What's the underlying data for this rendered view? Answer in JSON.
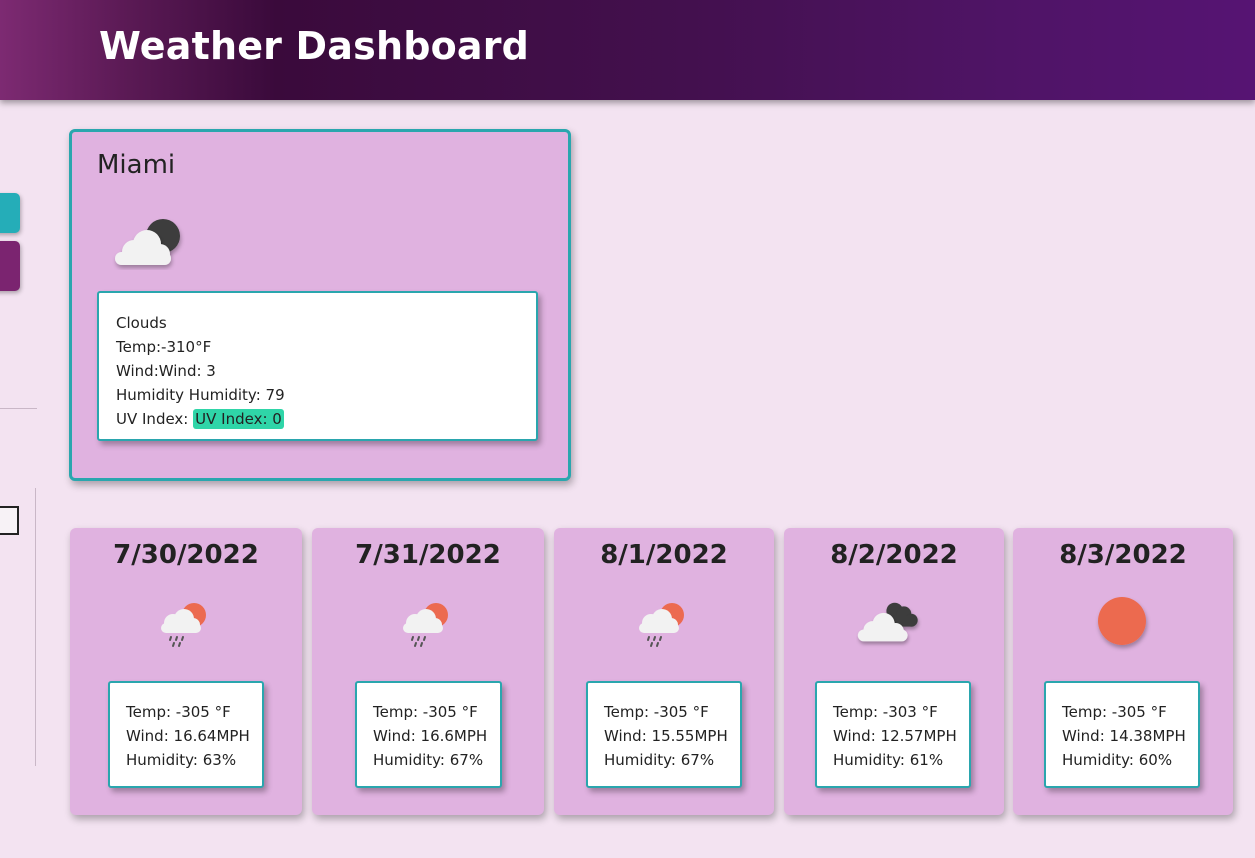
{
  "header": {
    "title": "Weather Dashboard"
  },
  "current": {
    "city": "Miami",
    "icon": "clouds-night-icon",
    "description": "Clouds",
    "temp_label": "Temp:",
    "temp": "-310°F",
    "wind_label": "Wind:",
    "wind": "Wind: 3",
    "humidity_label": "Humidity",
    "humidity": "Humidity: 79",
    "uv_label": "UV Index:",
    "uv": "UV Index: 0",
    "uv_color": "#2fd5a8"
  },
  "forecast": [
    {
      "date": "7/30/2022",
      "icon": "rain-sun-icon",
      "temp": "Temp: -305 °F",
      "wind": "Wind: 16.64MPH",
      "humidity": "Humidity: 63%"
    },
    {
      "date": "7/31/2022",
      "icon": "rain-sun-icon",
      "temp": "Temp: -305 °F",
      "wind": "Wind: 16.6MPH",
      "humidity": "Humidity: 67%"
    },
    {
      "date": "8/1/2022",
      "icon": "rain-sun-icon",
      "temp": "Temp: -305 °F",
      "wind": "Wind: 15.55MPH",
      "humidity": "Humidity: 67%"
    },
    {
      "date": "8/2/2022",
      "icon": "broken-clouds-icon",
      "temp": "Temp: -303 °F",
      "wind": "Wind: 12.57MPH",
      "humidity": "Humidity: 61%"
    },
    {
      "date": "8/3/2022",
      "icon": "sun-icon",
      "temp": "Temp: -305 °F",
      "wind": "Wind: 14.38MPH",
      "humidity": "Humidity: 60%"
    }
  ],
  "colors": {
    "accent": "#2aa6ae",
    "card": "#e0b2e0",
    "background": "#f3e3f1",
    "header": "#3a0a3b"
  }
}
